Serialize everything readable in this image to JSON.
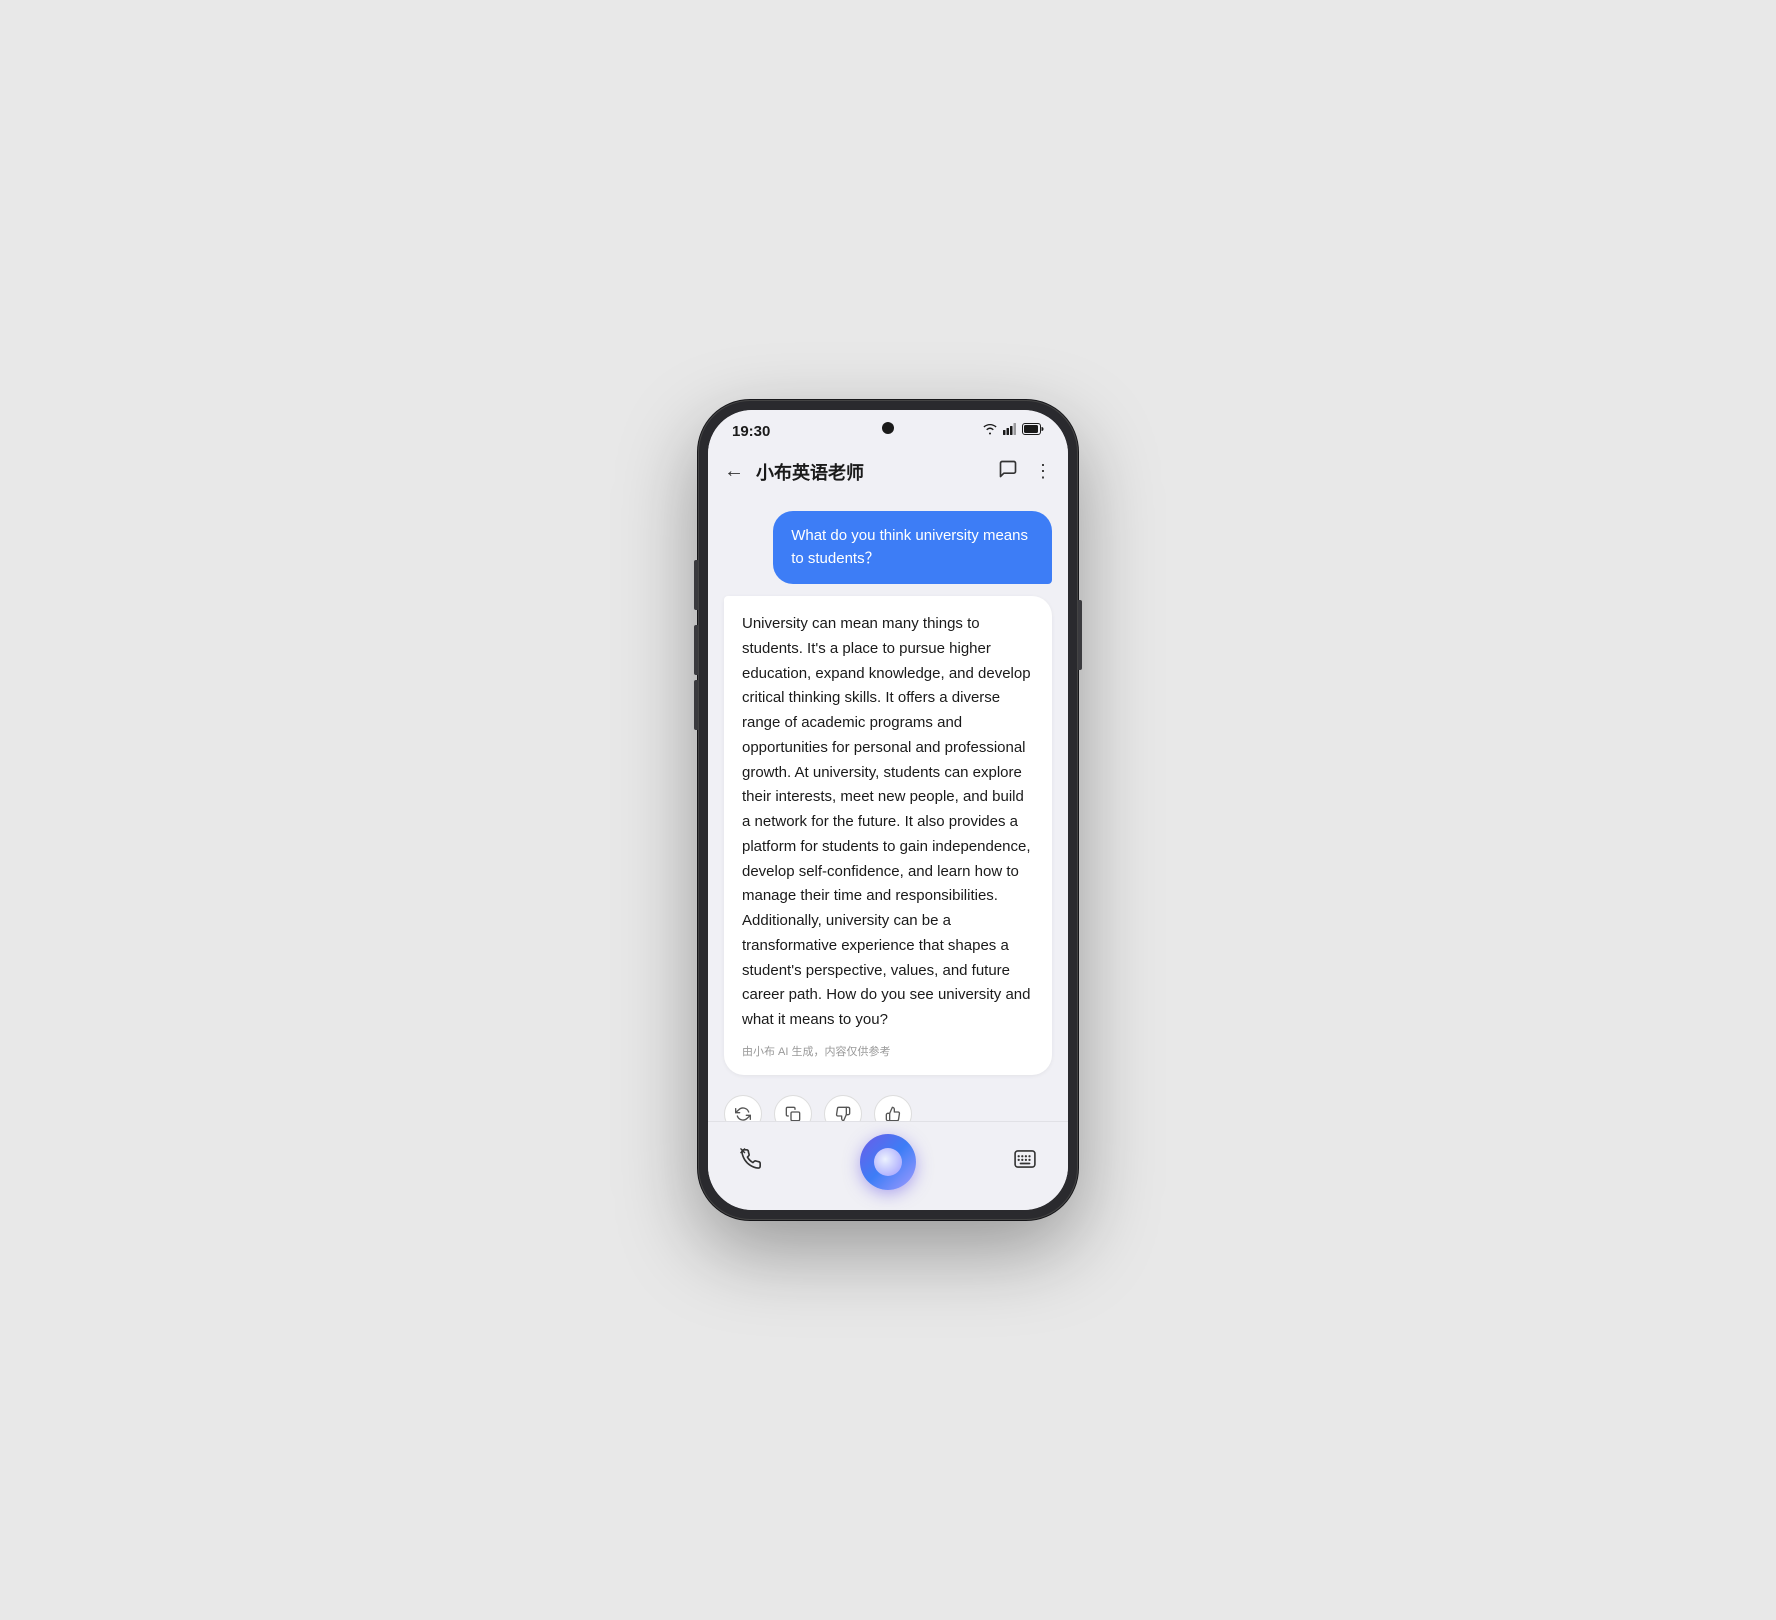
{
  "phone": {
    "statusBar": {
      "time": "19:30",
      "wifi": "wifi",
      "signal": "signal",
      "battery": "battery"
    },
    "header": {
      "backLabel": "←",
      "title": "小布英语老师",
      "iconChat": "💬",
      "iconMore": "⋮"
    },
    "chat": {
      "userMessage": "What do you think university means to students？",
      "aiResponse": "University can mean many things to students. It's a place to pursue higher education, expand knowledge, and develop critical thinking skills. It offers a diverse range of academic programs and opportunities for personal and professional growth. At university, students can explore their interests, meet new people, and build a network for the future. It also provides a platform for students to gain independence, develop self-confidence, and learn how to manage their time and responsibilities. Additionally, university can be a transformative experience that shapes a student's perspective, values, and future career path. How do you see university and what it means to you?",
      "attribution": "由小布 AI 生成，内容仅供参考"
    },
    "actions": {
      "refreshLabel": "↺",
      "copyLabel": "❐",
      "dislikeLabel": "👎",
      "likeLabel": "👍"
    },
    "bottomBar": {
      "phoneLabel": "📞",
      "keyboardLabel": "⌨"
    }
  }
}
